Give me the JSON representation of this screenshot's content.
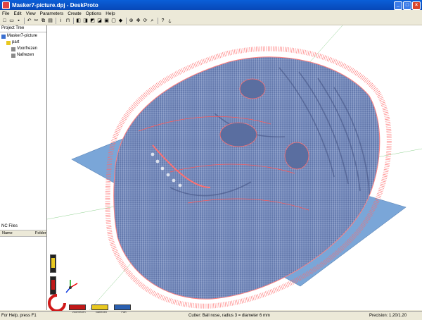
{
  "window": {
    "title": "Masker7-picture.dpj - DeskProto"
  },
  "menu": [
    "File",
    "Edit",
    "View",
    "Parameters",
    "Create",
    "Options",
    "Help"
  ],
  "toolbar": [
    "new-icon",
    "open-icon",
    "save-icon",
    "sep",
    "undo-icon",
    "cut-icon",
    "copy-icon",
    "paste-icon",
    "sep",
    "info-icon",
    "ruler-icon",
    "sep",
    "view-front-icon",
    "view-back-icon",
    "view-left-icon",
    "view-right-icon",
    "view-top-icon",
    "view-bottom-icon",
    "view-iso-icon",
    "sep",
    "zoom-fit-icon",
    "pan-icon",
    "rotate-icon",
    "zoom-icon",
    "sep",
    "help-icon",
    "context-help-icon"
  ],
  "project_tree": {
    "header": "Project Tree",
    "items": [
      {
        "label": "Masker7-picture",
        "level": 0,
        "icon": "project-icon"
      },
      {
        "label": "part",
        "level": 1,
        "icon": "bulb-icon"
      },
      {
        "label": "Voorfrezen",
        "level": 2,
        "icon": "operation-icon"
      },
      {
        "label": "Nafrezen",
        "level": 2,
        "icon": "operation-icon"
      }
    ]
  },
  "nc_files": {
    "header": "NC Files",
    "columns": [
      "Name",
      "Folder"
    ]
  },
  "legend": [
    {
      "label": "Voorfrezen",
      "color": "#c01818"
    },
    {
      "label": "Nafrezen",
      "color": "#e8c820"
    },
    {
      "label": "Part",
      "color": "#2a5fb0"
    }
  ],
  "status": {
    "help": "For Help, press F1",
    "cutter": "Cutter: Ball nose, radius 3 = diameter 6 mm",
    "precision": "Precision: 1.20/1.20"
  },
  "colors": {
    "mesh": "#6f86b8",
    "toolpath": "#ff6a6a",
    "plate": "#7aa6d8",
    "accent": "#0a5fd8"
  }
}
